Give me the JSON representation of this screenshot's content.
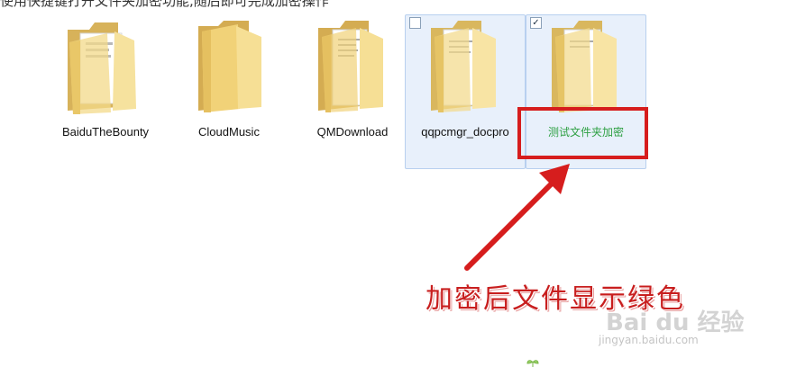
{
  "top_text": "使用快捷键打开文件夹加密功能,随后即可完成加密操作",
  "folders": [
    {
      "name": "BaiduTheBounty",
      "icon": "folder-with-documents-icon",
      "selected": false,
      "checked": false
    },
    {
      "name": "CloudMusic",
      "icon": "folder-icon",
      "selected": false,
      "checked": false
    },
    {
      "name": "QMDownload",
      "icon": "folder-with-documents-icon",
      "selected": false,
      "checked": false
    },
    {
      "name": "qqpcmgr_docpro",
      "icon": "folder-with-documents-icon",
      "selected": true,
      "checked": false
    },
    {
      "name": "测试文件夹加密",
      "icon": "folder-with-documents-icon",
      "selected": true,
      "checked": true,
      "label_color": "#2ea043"
    }
  ],
  "annotation": {
    "caption": "加密后文件显示绿色",
    "highlight_color": "#d61d1d"
  },
  "watermark": {
    "text": "Bai du 经验",
    "url": "jingyan.baidu.com"
  }
}
